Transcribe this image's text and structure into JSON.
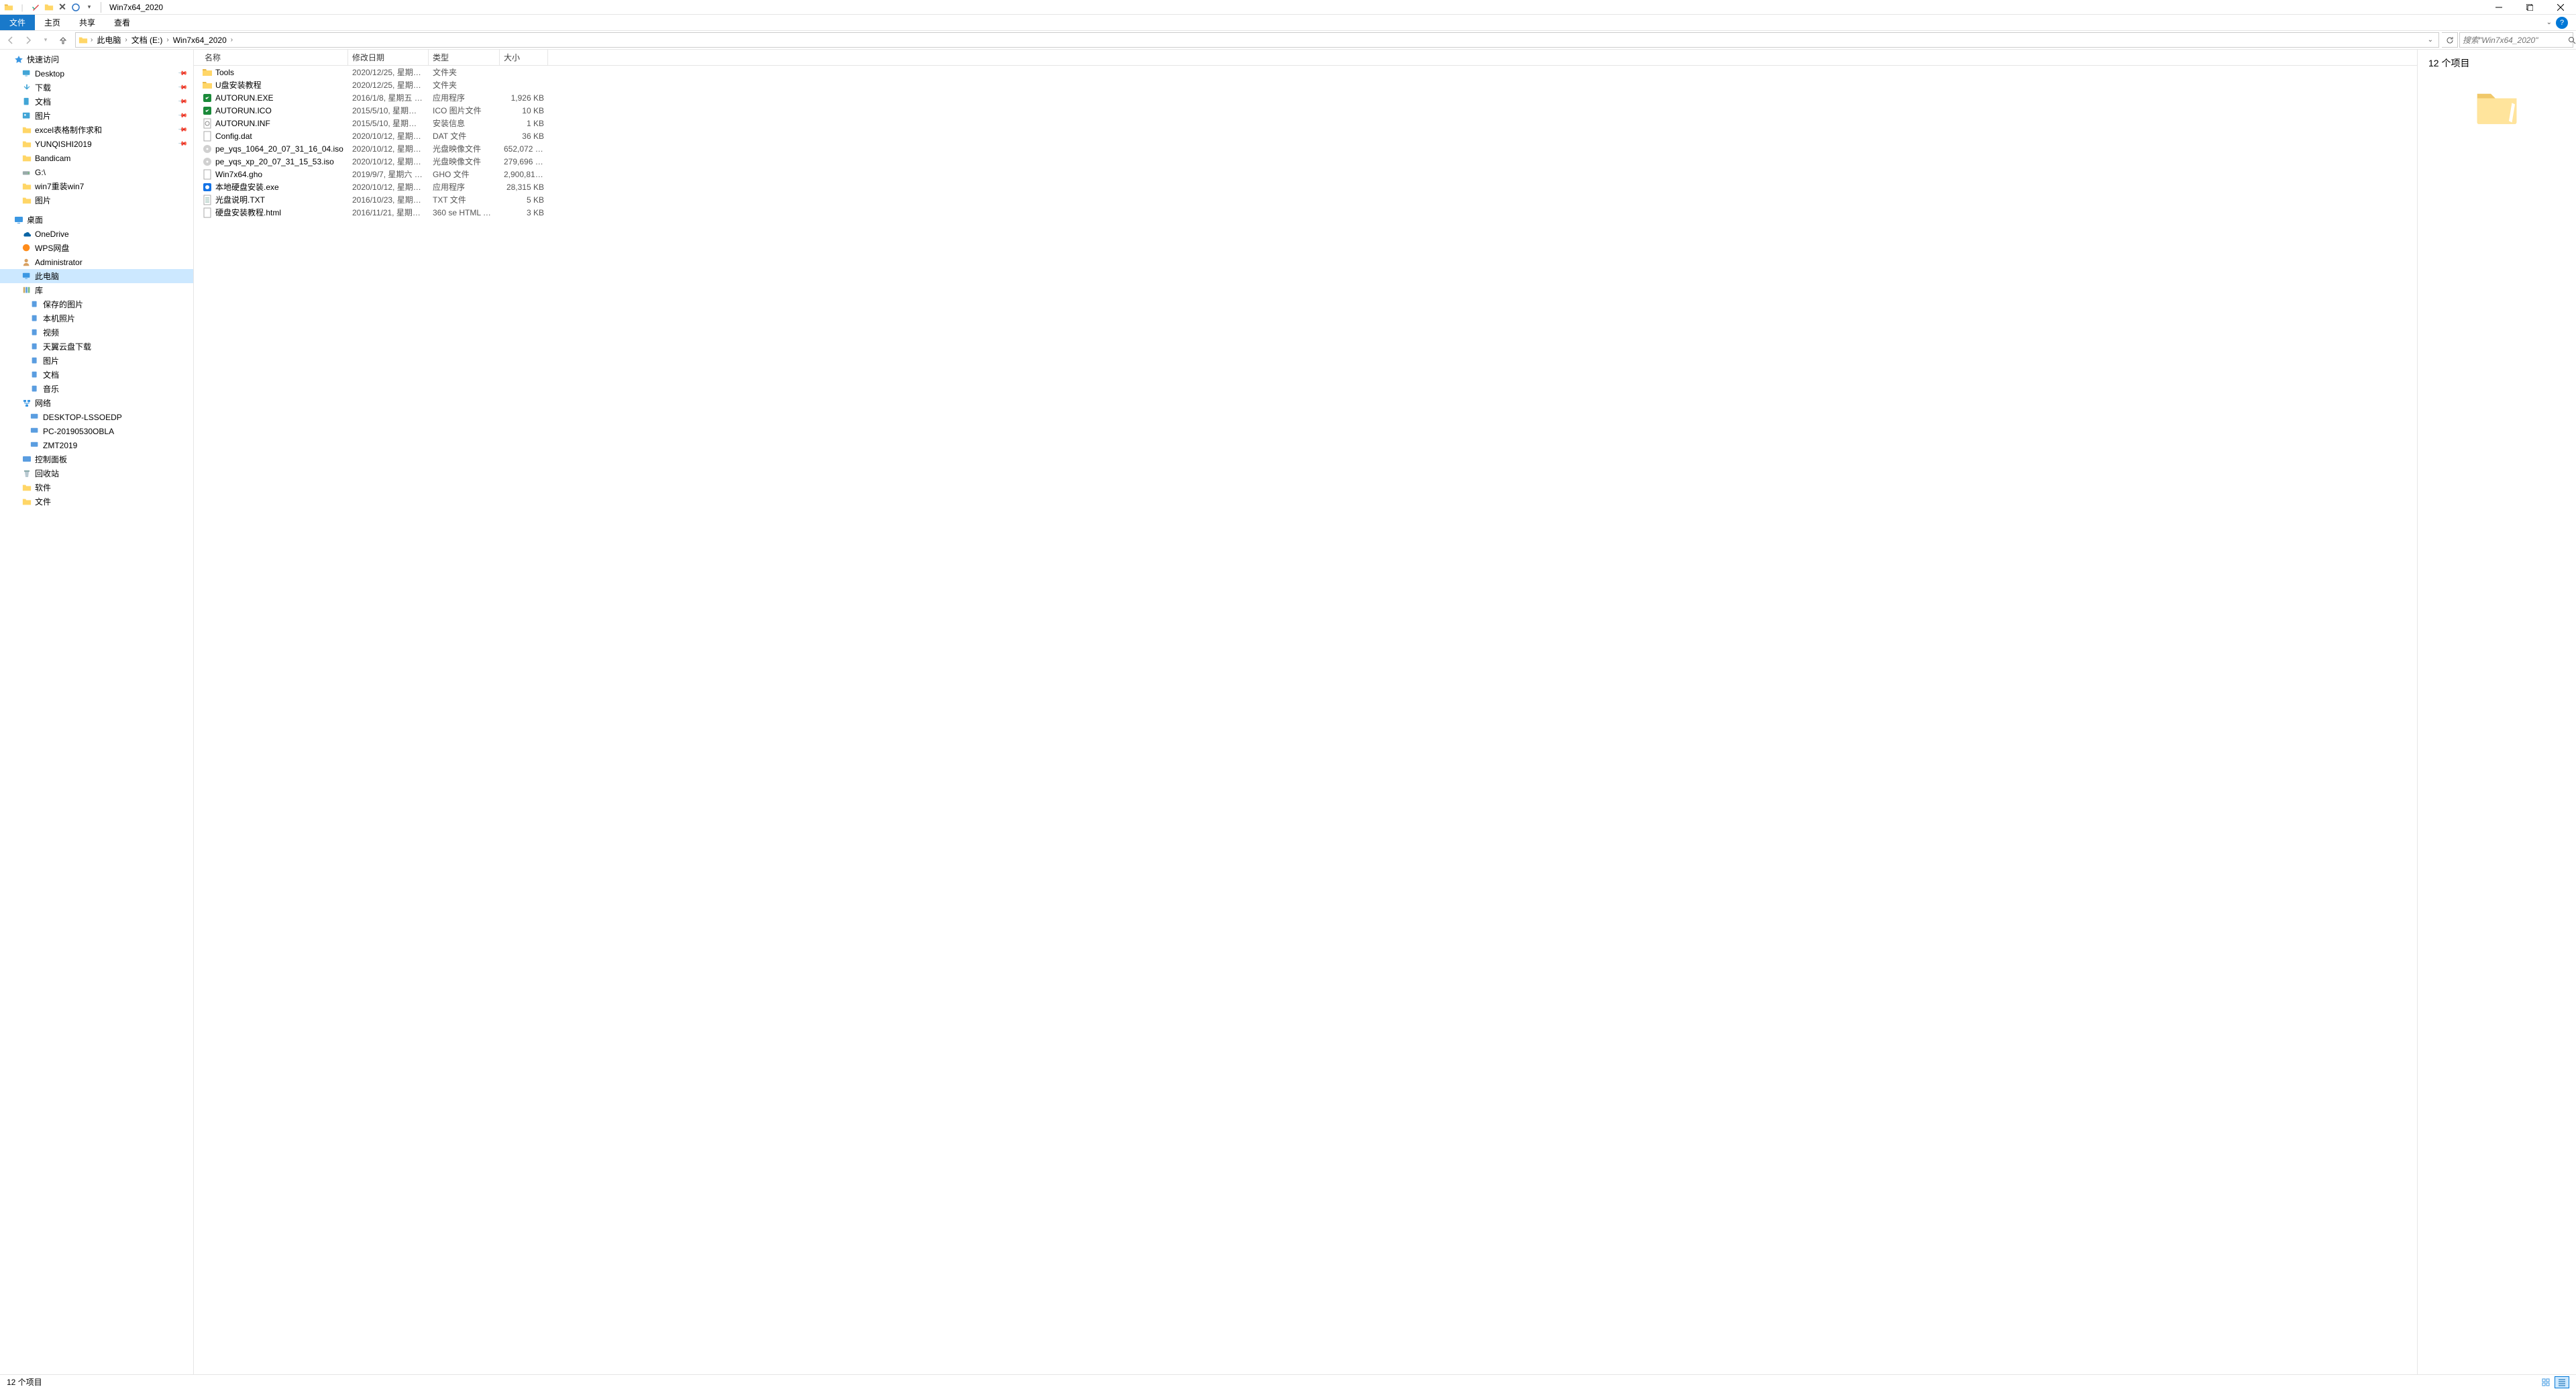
{
  "window": {
    "title": "Win7x64_2020"
  },
  "ribbon": {
    "file": "文件",
    "tabs": [
      "主页",
      "共享",
      "查看"
    ]
  },
  "breadcrumb": {
    "items": [
      "此电脑",
      "文档 (E:)",
      "Win7x64_2020"
    ],
    "refresh_dropdown": "⌄",
    "search_placeholder": "搜索\"Win7x64_2020\""
  },
  "nav": {
    "quick_access": "快速访问",
    "quick_items": [
      {
        "label": "Desktop",
        "pin": true,
        "icon": "desktop"
      },
      {
        "label": "下载",
        "pin": true,
        "icon": "downloads"
      },
      {
        "label": "文档",
        "pin": true,
        "icon": "documents"
      },
      {
        "label": "图片",
        "pin": true,
        "icon": "pictures"
      },
      {
        "label": "excel表格制作求和",
        "pin": true,
        "icon": "folder"
      },
      {
        "label": "YUNQISHI2019",
        "pin": true,
        "icon": "folder"
      },
      {
        "label": "Bandicam",
        "pin": false,
        "icon": "folder"
      },
      {
        "label": "G:\\",
        "pin": false,
        "icon": "drive"
      },
      {
        "label": "win7重装win7",
        "pin": false,
        "icon": "folder"
      },
      {
        "label": "图片",
        "pin": false,
        "icon": "folder"
      }
    ],
    "desktop": "桌面",
    "desktop_items": [
      {
        "label": "OneDrive",
        "icon": "onedrive"
      },
      {
        "label": "WPS网盘",
        "icon": "wps"
      },
      {
        "label": "Administrator",
        "icon": "user"
      },
      {
        "label": "此电脑",
        "icon": "pc",
        "selected": true
      },
      {
        "label": "库",
        "icon": "library"
      }
    ],
    "library_items": [
      {
        "label": "保存的图片",
        "icon": "lib"
      },
      {
        "label": "本机照片",
        "icon": "lib"
      },
      {
        "label": "视频",
        "icon": "lib"
      },
      {
        "label": "天翼云盘下载",
        "icon": "lib"
      },
      {
        "label": "图片",
        "icon": "lib"
      },
      {
        "label": "文档",
        "icon": "lib"
      },
      {
        "label": "音乐",
        "icon": "lib"
      }
    ],
    "network": "网络",
    "network_items": [
      {
        "label": "DESKTOP-LSSOEDP",
        "icon": "netpc"
      },
      {
        "label": "PC-20190530OBLA",
        "icon": "netpc"
      },
      {
        "label": "ZMT2019",
        "icon": "netpc"
      }
    ],
    "control_panel": "控制面板",
    "recycle": "回收站",
    "soft": "软件",
    "files_folder": "文件"
  },
  "columns": {
    "name": "名称",
    "date": "修改日期",
    "type": "类型",
    "size": "大小"
  },
  "files": [
    {
      "name": "Tools",
      "date": "2020/12/25, 星期五 1...",
      "type": "文件夹",
      "size": "",
      "icon": "folder"
    },
    {
      "name": "U盘安装教程",
      "date": "2020/12/25, 星期五 1...",
      "type": "文件夹",
      "size": "",
      "icon": "folder"
    },
    {
      "name": "AUTORUN.EXE",
      "date": "2016/1/8, 星期五 04:...",
      "type": "应用程序",
      "size": "1,926 KB",
      "icon": "exe-green"
    },
    {
      "name": "AUTORUN.ICO",
      "date": "2015/5/10, 星期日 02...",
      "type": "ICO 图片文件",
      "size": "10 KB",
      "icon": "exe-green"
    },
    {
      "name": "AUTORUN.INF",
      "date": "2015/5/10, 星期日 02...",
      "type": "安装信息",
      "size": "1 KB",
      "icon": "inf"
    },
    {
      "name": "Config.dat",
      "date": "2020/10/12, 星期一 1...",
      "type": "DAT 文件",
      "size": "36 KB",
      "icon": "blank"
    },
    {
      "name": "pe_yqs_1064_20_07_31_16_04.iso",
      "date": "2020/10/12, 星期一 1...",
      "type": "光盘映像文件",
      "size": "652,072 KB",
      "icon": "iso"
    },
    {
      "name": "pe_yqs_xp_20_07_31_15_53.iso",
      "date": "2020/10/12, 星期一 1...",
      "type": "光盘映像文件",
      "size": "279,696 KB",
      "icon": "iso"
    },
    {
      "name": "Win7x64.gho",
      "date": "2019/9/7, 星期六 19:...",
      "type": "GHO 文件",
      "size": "2,900,813...",
      "icon": "blank"
    },
    {
      "name": "本地硬盘安装.exe",
      "date": "2020/10/12, 星期一 1...",
      "type": "应用程序",
      "size": "28,315 KB",
      "icon": "exe-blue"
    },
    {
      "name": "光盘说明.TXT",
      "date": "2016/10/23, 星期日 0...",
      "type": "TXT 文件",
      "size": "5 KB",
      "icon": "txt"
    },
    {
      "name": "硬盘安装教程.html",
      "date": "2016/11/21, 星期一 2...",
      "type": "360 se HTML Do...",
      "size": "3 KB",
      "icon": "blank"
    }
  ],
  "preview": {
    "title": "12 个项目"
  },
  "status": {
    "text": "12 个项目"
  }
}
